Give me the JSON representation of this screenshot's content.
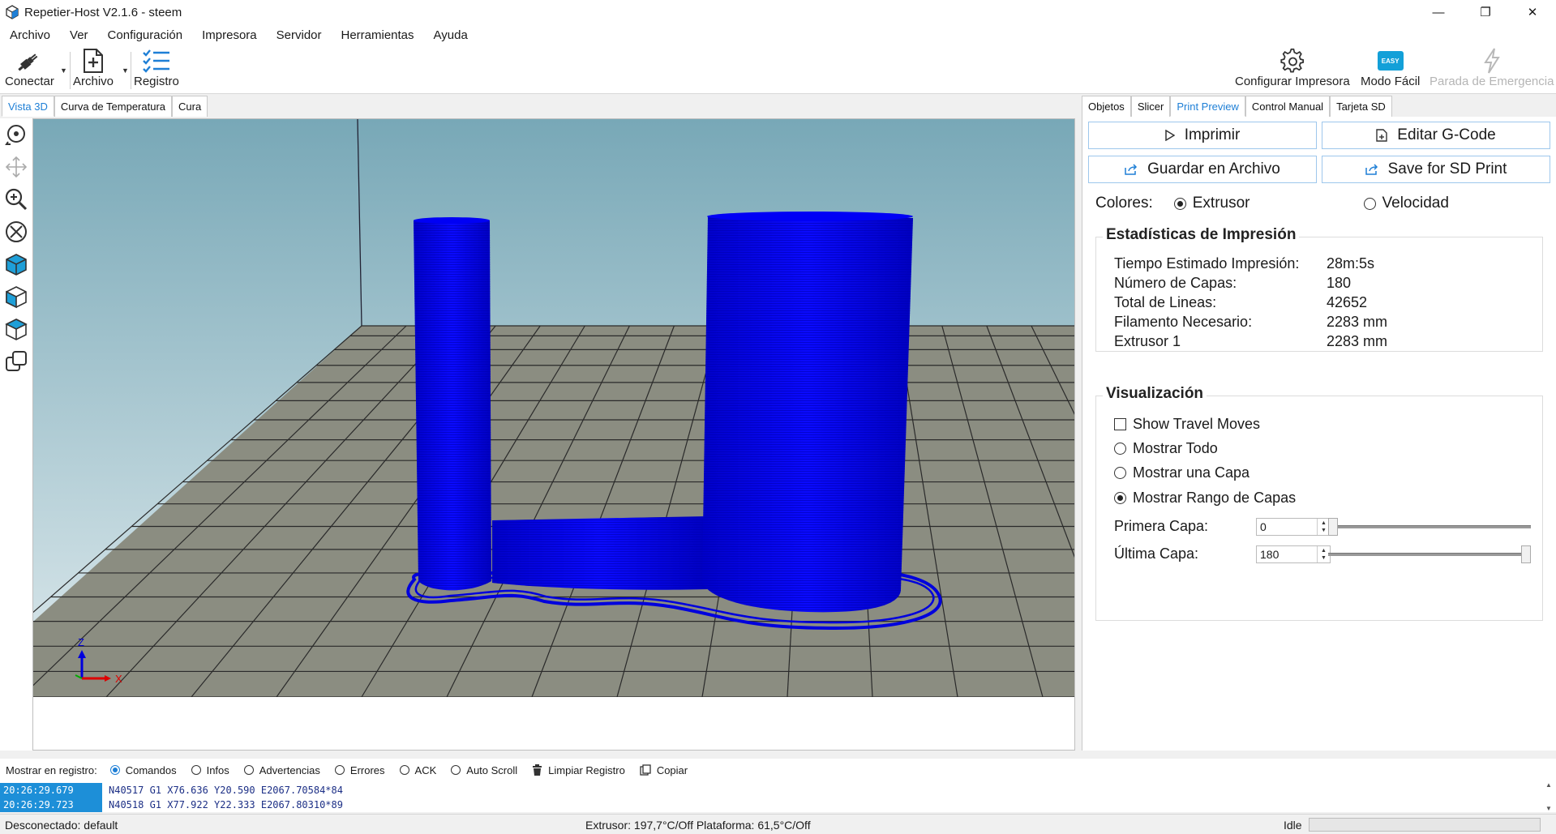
{
  "window": {
    "title": "Repetier-Host V2.1.6 - steem",
    "minimize": "—",
    "maximize": "❐",
    "close": "✕"
  },
  "menu": [
    "Archivo",
    "Ver",
    "Configuración",
    "Impresora",
    "Servidor",
    "Herramientas",
    "Ayuda"
  ],
  "toolbar": {
    "connect": "Conectar",
    "file": "Archivo",
    "log": "Registro",
    "configure_printer": "Configurar Impresora",
    "easy_mode": "Modo Fácil",
    "easy_badge": "EASY",
    "emergency_stop": "Parada de Emergencia"
  },
  "left_tabs": [
    "Vista 3D",
    "Curva de Temperatura",
    "Cura"
  ],
  "right_tabs": [
    "Objetos",
    "Slicer",
    "Print Preview",
    "Control Manual",
    "Tarjeta SD"
  ],
  "active_left_tab": "Vista 3D",
  "active_right_tab": "Print Preview",
  "viewport": {
    "axis_z": "Z",
    "axis_x": "X",
    "model_color": "#0000ee",
    "bed_color": "#8a8c80"
  },
  "print_preview": {
    "print_button": "Imprimir",
    "edit_gcode_button": "Editar G-Code",
    "save_file_button": "Guardar en Archivo",
    "save_sd_button": "Save for SD Print",
    "colors_label": "Colores:",
    "color_extruder": "Extrusor",
    "color_speed": "Velocidad",
    "stats_title": "Estadísticas de Impresión",
    "stats": [
      {
        "label": "Tiempo Estimado Impresión:",
        "value": "28m:5s"
      },
      {
        "label": "Número de Capas:",
        "value": "180"
      },
      {
        "label": "Total de Lineas:",
        "value": "42652"
      },
      {
        "label": "Filamento Necesario:",
        "value": "2283 mm"
      },
      {
        "label": "Extrusor 1",
        "value": "2283 mm"
      }
    ],
    "vis_title": "Visualización",
    "show_travel": "Show Travel Moves",
    "show_all": "Mostrar Todo",
    "show_one_layer": "Mostrar una Capa",
    "show_layer_range": "Mostrar Rango de Capas",
    "first_layer_label": "Primera Capa:",
    "first_layer_value": "0",
    "last_layer_label": "Última Capa:",
    "last_layer_value": "180",
    "layer_max": 180
  },
  "log": {
    "show_label": "Mostrar en registro:",
    "commands": "Comandos",
    "infos": "Infos",
    "warnings": "Advertencias",
    "errors": "Errores",
    "ack": "ACK",
    "auto_scroll": "Auto Scroll",
    "clear": "Limpiar Registro",
    "copy": "Copiar",
    "lines": [
      {
        "time": "20:26:29.679",
        "text": "N40517 G1 X76.636 Y20.590 E2067.70584*84"
      },
      {
        "time": "20:26:29.723",
        "text": "N40518 G1 X77.922 Y22.333 E2067.80310*89"
      }
    ]
  },
  "status": {
    "connection": "Desconectado: default",
    "temps": "Extrusor: 197,7°C/Off Plataforma: 61,5°C/Off",
    "state": "Idle"
  }
}
